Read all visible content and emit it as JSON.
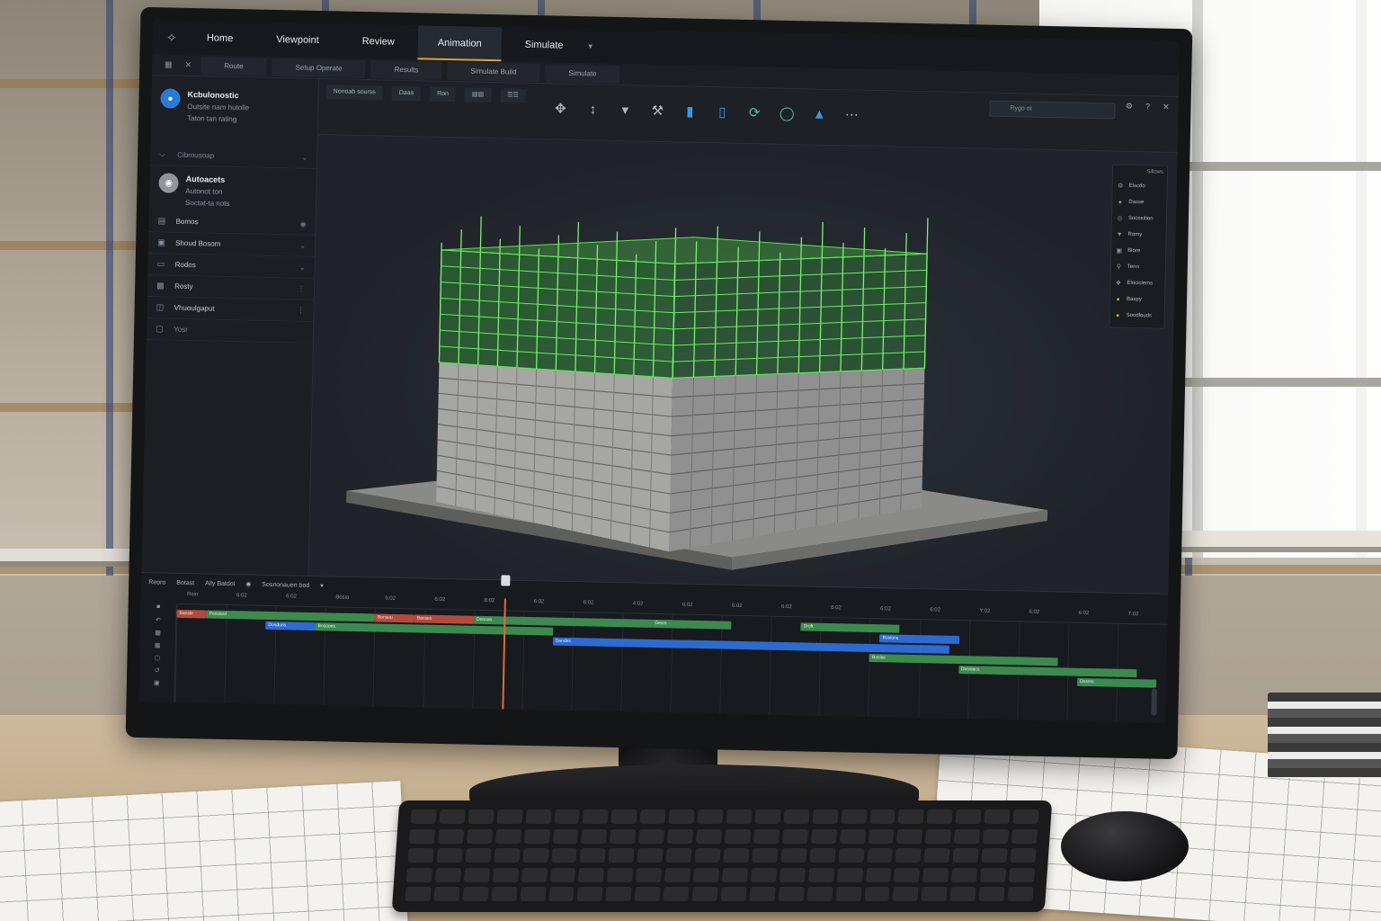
{
  "menubar": {
    "items": [
      {
        "label": "Home"
      },
      {
        "label": "Viewpoint"
      },
      {
        "label": "Review"
      },
      {
        "label": "Animation"
      },
      {
        "label": "Simulate"
      }
    ]
  },
  "subtabs": [
    "Route",
    "Setup Operate",
    "Results",
    "Simulate Build",
    "Simulate"
  ],
  "sidebar": {
    "profile1": {
      "name": "Kcbulonostic",
      "line1": "Outsite nam hutolle",
      "line2": "Taton tan rating"
    },
    "row_collapse": "Cibrousoap",
    "profile2": {
      "name": "Autoacets",
      "line1": "Autonot ton",
      "line2": "Soctat-ta nots"
    },
    "items": [
      {
        "label": "Bomos"
      },
      {
        "label": "Shoud Bosom"
      },
      {
        "label": "Rodos"
      },
      {
        "label": "Rosty"
      },
      {
        "label": "Vhuoulgaput"
      },
      {
        "label": "Yosr"
      }
    ]
  },
  "toolbar": {
    "btn1": "Nonoab sourss",
    "btn2": "Daas",
    "btn3": "Ron",
    "search_placeholder": "Rygo ot"
  },
  "right_panel": {
    "title": "Sillows",
    "items": [
      {
        "label": "Elscdo"
      },
      {
        "label": "Dasse"
      },
      {
        "label": "Socosition"
      },
      {
        "label": "Romy"
      },
      {
        "label": "Blore"
      },
      {
        "label": "Tenn"
      },
      {
        "label": "Elociclems"
      },
      {
        "label": "Baspy"
      },
      {
        "label": "Soodlouds"
      }
    ]
  },
  "timeline": {
    "head": [
      "Reoro",
      "Botast",
      "Ally Batdol",
      "Sosnonauen bod"
    ],
    "ticks": [
      "Roin",
      "6:02",
      "6:02",
      "Bosio",
      "6:02",
      "6:02",
      "8:02",
      "6:02",
      "6:02",
      "4:02",
      "6:02",
      "6:02",
      "6:02",
      "6:02",
      "6:02",
      "6:02",
      "Y:02",
      "6:02",
      "6:02",
      "7:02"
    ],
    "bars": [
      {
        "label": "Bansle",
        "color": "red",
        "start": 0,
        "end": 0.03,
        "row": 0
      },
      {
        "label": "Ponsisrd",
        "color": "green",
        "start": 0.03,
        "end": 0.2,
        "row": 0
      },
      {
        "label": "Bonsou",
        "color": "red",
        "start": 0.2,
        "end": 0.24,
        "row": 0
      },
      {
        "label": "Basses",
        "color": "red",
        "start": 0.24,
        "end": 0.3,
        "row": 0
      },
      {
        "label": "Donoas",
        "color": "green",
        "start": 0.3,
        "end": 0.48,
        "row": 0
      },
      {
        "label": "Desm",
        "color": "green",
        "start": 0.48,
        "end": 0.56,
        "row": 0
      },
      {
        "label": "Droft",
        "color": "green",
        "start": 0.63,
        "end": 0.73,
        "row": 0
      },
      {
        "label": "Dosdons",
        "color": "blue",
        "start": 0.09,
        "end": 0.14,
        "row": 1
      },
      {
        "label": "Bosooes",
        "color": "green",
        "start": 0.14,
        "end": 0.38,
        "row": 1
      },
      {
        "label": "Dandes",
        "color": "blue",
        "start": 0.38,
        "end": 0.78,
        "row": 2
      },
      {
        "label": "Bosions",
        "color": "blue",
        "start": 0.71,
        "end": 0.79,
        "row": 1
      },
      {
        "label": "Bosiac",
        "color": "green",
        "start": 0.7,
        "end": 0.89,
        "row": 3
      },
      {
        "label": "Dossiacs",
        "color": "green",
        "start": 0.79,
        "end": 0.97,
        "row": 4
      },
      {
        "label": "Dosms",
        "color": "green",
        "start": 0.91,
        "end": 0.99,
        "row": 5
      }
    ],
    "playhead": 0.33
  },
  "colors": {
    "accent": "#d8a13c",
    "structure_green": "#39c23a",
    "concrete": "#b9b9b4"
  }
}
